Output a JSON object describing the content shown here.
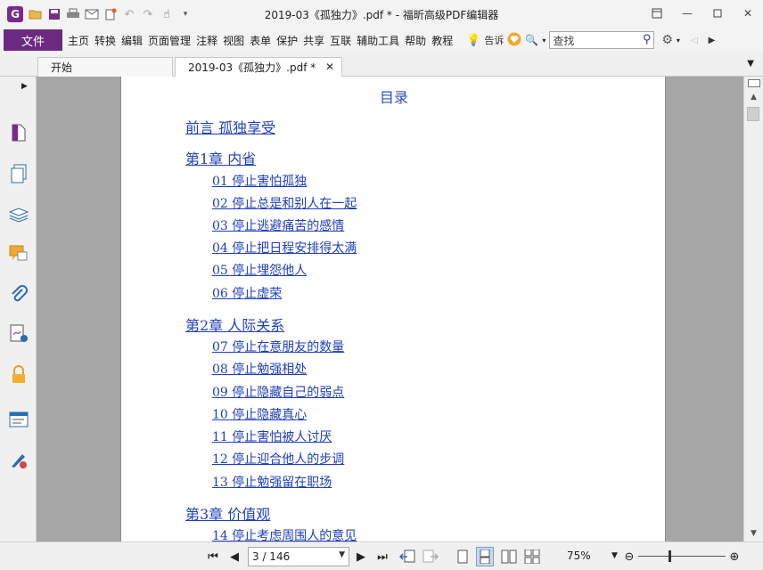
{
  "window": {
    "title": "2019-03《孤独力》.pdf * - 福昕高级PDF编辑器"
  },
  "menu": {
    "file": "文件",
    "items": [
      "主页",
      "转换",
      "编辑",
      "页面管理",
      "注释",
      "视图",
      "表单",
      "保护",
      "共享",
      "互联",
      "辅助工具",
      "帮助",
      "教程"
    ],
    "tell": "告诉",
    "search_value": "查找"
  },
  "tabs": [
    {
      "label": "开始"
    },
    {
      "label": "2019-03《孤独力》.pdf *"
    }
  ],
  "toc": {
    "title": "目录",
    "entries": [
      {
        "text": "前言 孤独享受",
        "level": 1
      },
      {
        "text": "第1章 内省",
        "level": 1
      },
      {
        "text": "01 停止害怕孤独",
        "level": 2
      },
      {
        "text": "02 停止总是和别人在一起",
        "level": 2
      },
      {
        "text": "03 停止逃避痛苦的感情",
        "level": 2
      },
      {
        "text": "04 停止把日程安排得太满",
        "level": 2
      },
      {
        "text": "05 停止埋怨他人",
        "level": 2
      },
      {
        "text": "06 停止虚荣",
        "level": 2
      },
      {
        "text": "第2章 人际关系",
        "level": 1
      },
      {
        "text": "07 停止在意朋友的数量",
        "level": 2
      },
      {
        "text": "08 停止勉强相处",
        "level": 2
      },
      {
        "text": "09 停止隐藏自己的弱点",
        "level": 2
      },
      {
        "text": "10 停止隐藏真心",
        "level": 2
      },
      {
        "text": "11 停止害怕被人讨厌",
        "level": 2
      },
      {
        "text": "12 停止迎合他人的步调",
        "level": 2
      },
      {
        "text": "13 停止勉强留在职场",
        "level": 2
      },
      {
        "text": "第3章 价值观",
        "level": 1
      },
      {
        "text": "14 停止考虑周围人的意见",
        "level": 2
      }
    ]
  },
  "status": {
    "page_value": "3 / 146",
    "zoom": "75%",
    "zoom_level_fraction": 0.35
  },
  "colors": {
    "accent": "#6b2a80",
    "link": "#1f3fbf"
  }
}
